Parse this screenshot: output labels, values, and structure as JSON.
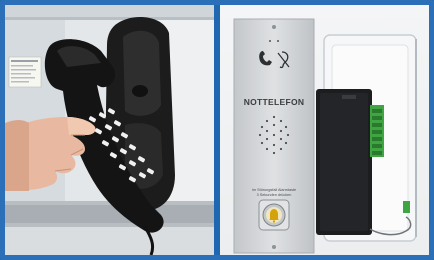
{
  "photo_left": {
    "subject": "black-corded-emergency-handset",
    "sticker_lines": [
      "Notruf",
      "Notfallnummer",
      "Hausmeister",
      "Empfang",
      "Technik"
    ]
  },
  "photo_right": {
    "plate_title": "NOTTELEFON",
    "plate_instruction": [
      "Im Störungsfall Alarmtaste",
      "3 Sekunden drücken"
    ],
    "module_label": "",
    "icons": [
      "phone-icon",
      "hearing-aid-icon",
      "bell-icon"
    ]
  }
}
